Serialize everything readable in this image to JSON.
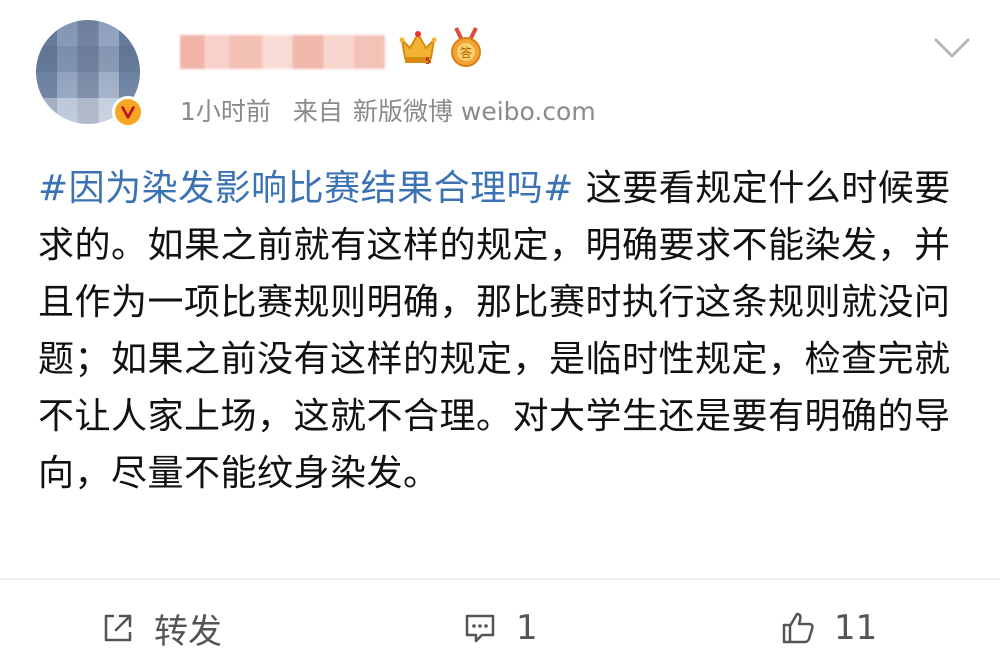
{
  "post": {
    "meta": {
      "time": "1小时前",
      "source_prefix": "来自",
      "source": "新版微博 weibo.com"
    },
    "hashtag": "#因为染发影响比赛结果合理吗#",
    "body": " 这要看规定什么时候要求的。如果之前就有这样的规定，明确要求不能染发，并且作为一项比赛规则明确，那比赛时执行这条规则就没问题；如果之前没有这样的规定，是临时性规定，检查完就不让人家上场，这就不合理。对大学生还是要有明确的导向，尽量不能纹身染发。"
  },
  "actions": {
    "repost_label": "转发",
    "comment_count": "1",
    "like_count": "11"
  },
  "icons": {
    "verified": "verified-v-icon",
    "crown": "crown-badge-icon",
    "medal": "answer-medal-icon",
    "chevron": "chevron-down-icon",
    "repost": "share-icon",
    "comment": "comment-icon",
    "like": "thumbs-up-icon"
  },
  "colors": {
    "hashtag": "#3b72b4",
    "meta": "#8a8a8a",
    "verified": "#f5a623"
  }
}
